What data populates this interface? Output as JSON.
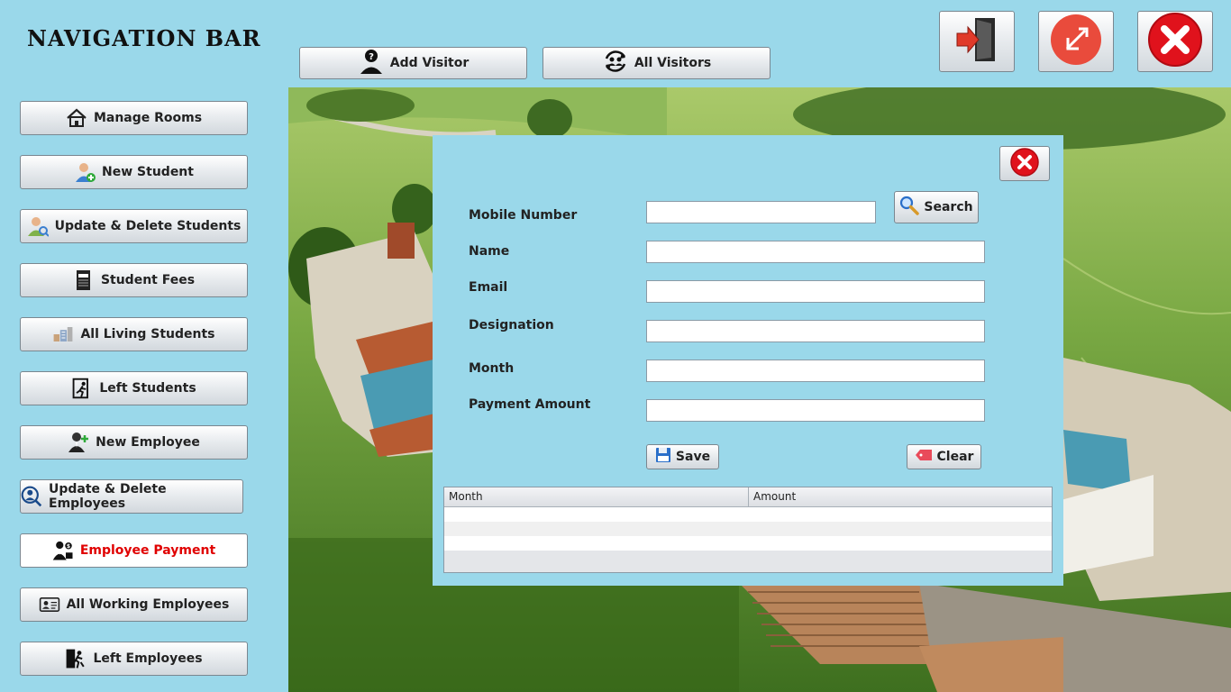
{
  "nav": {
    "title": "NAVIGATION BAR",
    "items": [
      {
        "label": "Manage Rooms",
        "icon": "house-icon"
      },
      {
        "label": "New Student",
        "icon": "student-add-icon"
      },
      {
        "label": "Update & Delete Students",
        "icon": "student-search-icon"
      },
      {
        "label": "Student Fees",
        "icon": "fees-icon"
      },
      {
        "label": "All Living Students",
        "icon": "buildings-icon"
      },
      {
        "label": "Left Students",
        "icon": "exit-icon"
      },
      {
        "label": "New Employee",
        "icon": "employee-add-icon"
      },
      {
        "label": "Update & Delete Employees",
        "icon": "employee-search-icon"
      },
      {
        "label": "Employee Payment",
        "icon": "employee-payment-icon",
        "active": true
      },
      {
        "label": "All Working Employees",
        "icon": "id-card-icon"
      },
      {
        "label": "Left Employees",
        "icon": "door-exit-icon"
      }
    ]
  },
  "top": {
    "add_visitor": "Add Visitor",
    "all_visitors": "All Visitors"
  },
  "window_buttons": {
    "logout_icon": "logout-icon",
    "minimize_icon": "minimize-icon",
    "close_icon": "close-icon"
  },
  "form": {
    "mobile_label": "Mobile Number",
    "name_label": "Name",
    "email_label": "Email",
    "designation_label": "Designation",
    "month_label": "Month",
    "payment_label": "Payment Amount",
    "mobile_value": "",
    "name_value": "",
    "email_value": "",
    "designation_value": "",
    "month_value": "",
    "payment_value": "",
    "search_label": "Search",
    "save_label": "Save",
    "clear_label": "Clear"
  },
  "table": {
    "columns": [
      "Month",
      "Amount"
    ],
    "rows": []
  },
  "colors": {
    "background": "#9ad8ea",
    "active_text": "#e00000"
  }
}
